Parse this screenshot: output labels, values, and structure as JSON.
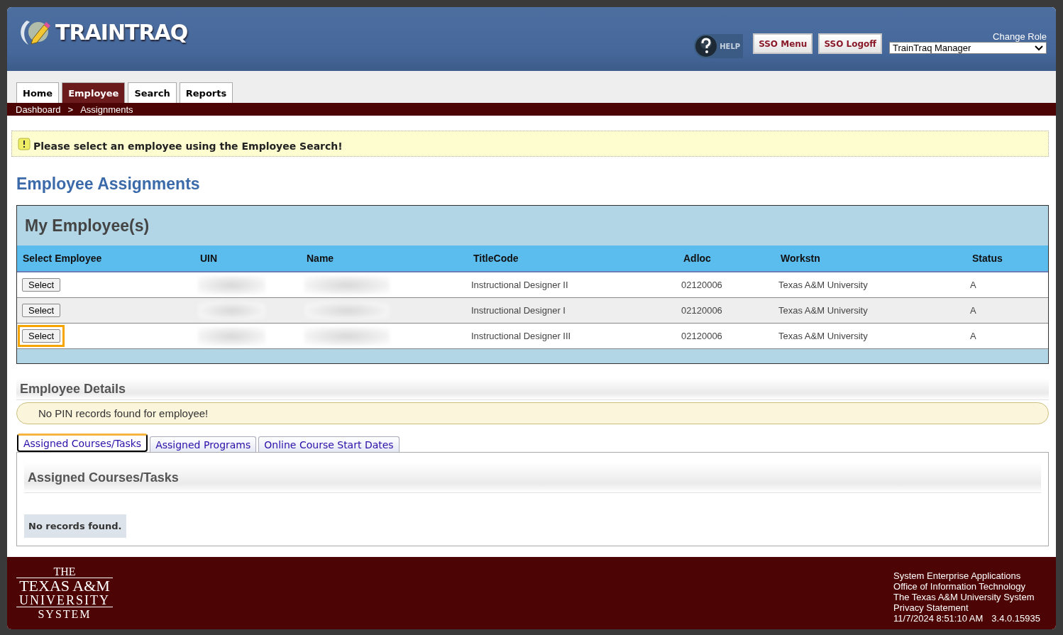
{
  "header": {
    "logo": "TRAINTRAQ",
    "help": "HELP",
    "buttons": [
      "SSO Menu",
      "SSO Logoff"
    ],
    "role_label": "Change Role",
    "role_value": "TrainTraq Manager"
  },
  "nav": [
    {
      "label": "Home",
      "selected": false
    },
    {
      "label": "Employee",
      "selected": true
    },
    {
      "label": "Search",
      "selected": false
    },
    {
      "label": "Reports",
      "selected": false
    }
  ],
  "breadcrumb": {
    "items": [
      "Dashboard",
      "Assignments"
    ],
    "separator": ">"
  },
  "alert": "Please select an employee using the Employee Search!",
  "page_title": "Employee Assignments",
  "employees": {
    "title": "My Employee(s)",
    "columns": [
      "Select Employee",
      "UIN",
      "Name",
      "TitleCode",
      "Adloc",
      "Workstn",
      "Status"
    ],
    "rows": [
      {
        "button": "Select",
        "highlighted": false,
        "uin": {
          "redacted": true
        },
        "name": {
          "redacted": true
        },
        "titlecode": "Instructional Designer II",
        "adloc": "02120006",
        "workstn": "Texas A&M University",
        "status": "A"
      },
      {
        "button": "Select",
        "highlighted": false,
        "uin": {
          "redacted": true
        },
        "name": {
          "redacted": true
        },
        "titlecode": "Instructional Designer I",
        "adloc": "02120006",
        "workstn": "Texas A&M University",
        "status": "A"
      },
      {
        "button": "Select",
        "highlighted": true,
        "uin": {
          "redacted": true
        },
        "name": {
          "redacted": true
        },
        "titlecode": "Instructional Designer III",
        "adloc": "02120006",
        "workstn": "Texas A&M University",
        "status": "A"
      }
    ]
  },
  "details": {
    "title": "Employee Details",
    "message": "No PIN records found for employee!"
  },
  "subtabs": [
    {
      "label": "Assigned Courses/Tasks",
      "selected": true
    },
    {
      "label": "Assigned Programs",
      "selected": false
    },
    {
      "label": "Online Course Start Dates",
      "selected": false
    }
  ],
  "panel": {
    "title": "Assigned Courses/Tasks",
    "empty": "No records found."
  },
  "footer": {
    "logo_lines": [
      "THE",
      "TEXAS A&M",
      "UNIVERSITY",
      "SYSTEM"
    ],
    "lines": [
      "System Enterprise Applications",
      "Office of Information Technology",
      "The Texas A&M University System"
    ],
    "privacy": "Privacy Statement",
    "timestamp": "11/7/2024 8:51:10 AM",
    "version": "3.4.0.15935"
  }
}
